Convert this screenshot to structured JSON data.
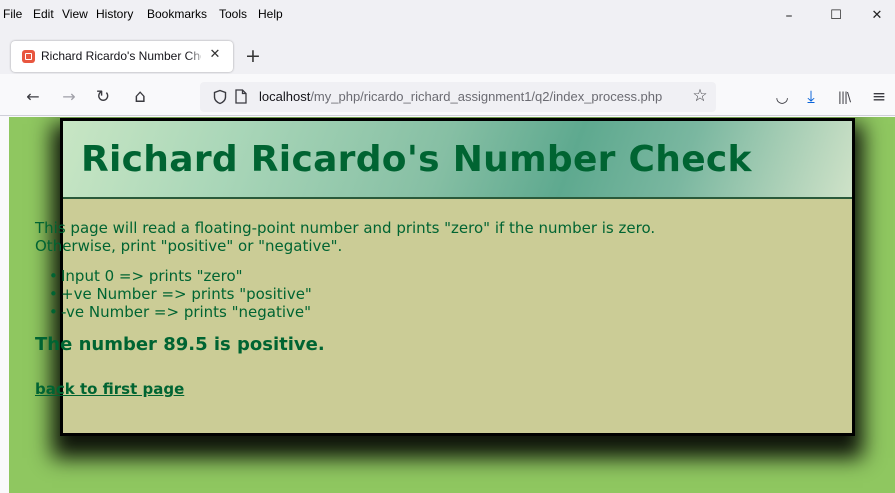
{
  "menu": [
    "File",
    "Edit",
    "View",
    "History",
    "Bookmarks",
    "Tools",
    "Help"
  ],
  "window_controls": {
    "minimize": "–",
    "maximize": "☐",
    "close": "✕"
  },
  "tab": {
    "title": "Richard Ricardo's Number Check",
    "close": "✕"
  },
  "new_tab": "+",
  "nav": {
    "back": "←",
    "forward": "→",
    "reload": "↻",
    "home": "⌂"
  },
  "url": {
    "host": "localhost",
    "path": "/my_php/ricardo_richard_assignment1/q2/index_process.php"
  },
  "toolbar": {
    "bookmark_star": "☆",
    "pocket": "◡",
    "download": "⤓",
    "library": "|||\\",
    "menu": "≡"
  },
  "page": {
    "title": "Richard Ricardo's Number Check",
    "intro": "This page will read a floating-point number and prints \"zero\" if the number is zero. Otherwise, print \"positive\" or \"negative\".",
    "rules": [
      "Input 0 => prints \"zero\"",
      "+ve Number => prints \"positive\"",
      "-ve Number => prints \"negative\""
    ],
    "result": "The number 89.5 is positive.",
    "back_link": "back to first page"
  },
  "colors": {
    "page_background": "#8fc760",
    "card_background": "#cbcc96",
    "text": "#006432"
  }
}
